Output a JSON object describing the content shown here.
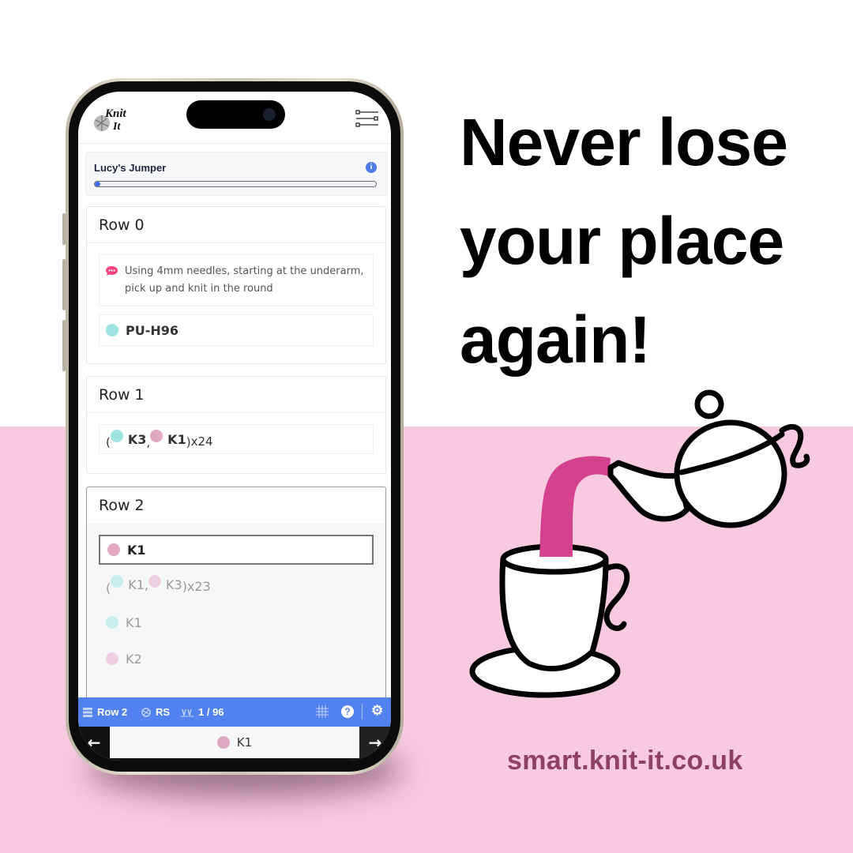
{
  "headline": {
    "lines": [
      "Never lose",
      "your place",
      "again!"
    ]
  },
  "website": "smart.knit-it.co.uk",
  "colors": {
    "pink_bg": "#f7cadf",
    "url": "#8e4163",
    "accent_blue": "#5182ef",
    "tea": "#d4418e",
    "teal_yarn": "#9fe3e1",
    "pink_yarn": "#e2a7c1"
  },
  "app": {
    "logo": "Knit It",
    "menu_icon": "sliders-menu-icon",
    "project": {
      "title": "Lucy's Jumper",
      "progress_percent": 1
    },
    "rows": [
      {
        "label": "Row 0",
        "note": "Using 4mm needles, starting at the underarm, pick up and knit in the round",
        "stitch": "PU-H96",
        "stitch_color": "teal"
      },
      {
        "label": "Row 1",
        "repeat": {
          "open": "(",
          "a": "K3",
          "sep": ",",
          "b": "K1",
          "close": ")",
          "count": "x24"
        }
      },
      {
        "label": "Row 2",
        "current": "K1",
        "repeat": {
          "open": "(",
          "a": "K1",
          "sep": ",",
          "b": "K3",
          "close": ")",
          "count": "x23"
        },
        "next": [
          {
            "text": "K1",
            "color": "teal"
          },
          {
            "text": "K2",
            "color": "pink"
          }
        ]
      }
    ],
    "status": {
      "row": "Row 2",
      "side": "RS",
      "stitch_count": "1 / 96"
    },
    "nav": {
      "prev": "←",
      "current": "K1",
      "next": "→"
    }
  }
}
